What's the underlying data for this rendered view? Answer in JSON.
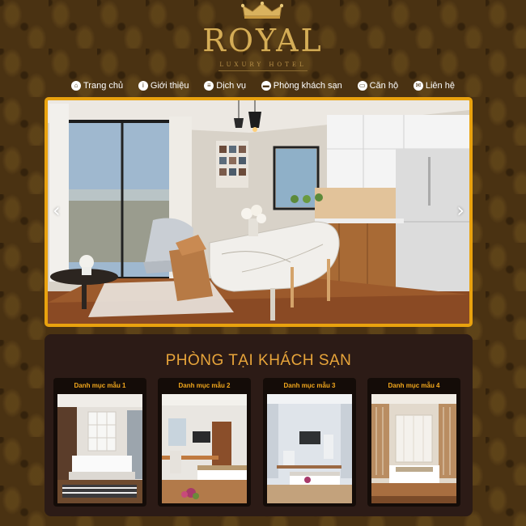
{
  "logo": {
    "brand": "ROYAL",
    "subtitle": "LUXURY HOTEL",
    "crown_icon": "crown-icon"
  },
  "nav": {
    "items": [
      {
        "label": "Trang chủ",
        "icon": "home-icon"
      },
      {
        "label": "Giới thiệu",
        "icon": "info-icon"
      },
      {
        "label": "Dịch vụ",
        "icon": "service-icon"
      },
      {
        "label": "Phòng khách sạn",
        "icon": "bed-icon"
      },
      {
        "label": "Căn hộ",
        "icon": "apartment-icon"
      },
      {
        "label": "Liên hệ",
        "icon": "contact-icon"
      }
    ]
  },
  "slider": {
    "prev_symbol": "‹",
    "next_symbol": "›"
  },
  "rooms": {
    "title": "PHÒNG TẠI KHÁCH SẠN",
    "cards": [
      {
        "label": "Danh mục mẫu 1"
      },
      {
        "label": "Danh mục mẫu 2"
      },
      {
        "label": "Danh mục mẫu 3"
      },
      {
        "label": "Danh mục mẫu 4"
      }
    ]
  },
  "colors": {
    "accent": "#e9a20e",
    "gold": "#d4ad57",
    "panel": "#2c1b16",
    "background": "#4a3212"
  }
}
